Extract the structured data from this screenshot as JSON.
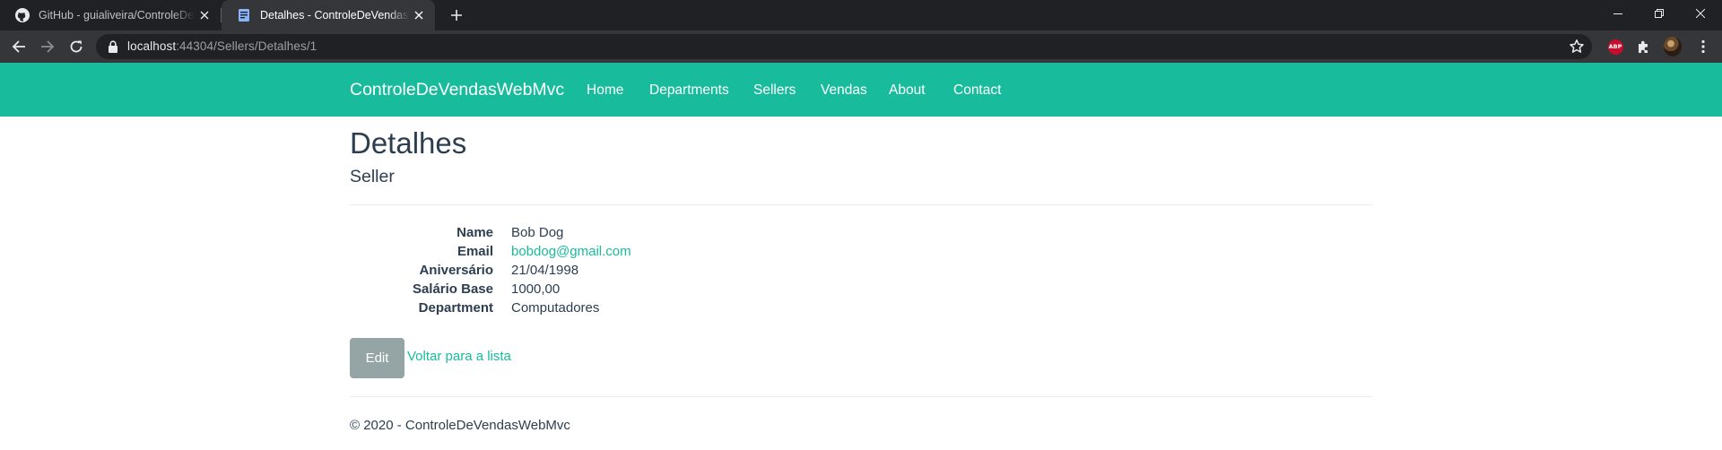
{
  "browser": {
    "tabs": [
      {
        "title": "GitHub - guialiveira/ControleDeVendasWebMvc",
        "favicon": "github-icon",
        "active": false
      },
      {
        "title": "Detalhes - ControleDeVendasWebMvc",
        "favicon": "document-icon",
        "active": true
      }
    ],
    "url": {
      "host": "localhost",
      "rest": ":44304/Sellers/Detalhes/1"
    },
    "extensions": {
      "abp_label": "ABP"
    }
  },
  "navbar": {
    "brand": "ControleDeVendasWebMvc",
    "links": [
      "Home",
      "Departments",
      "Sellers",
      "Vendas",
      "About",
      "Contact"
    ],
    "color": "#18bc9c"
  },
  "page": {
    "title": "Detalhes",
    "subtitle": "Seller",
    "fields": [
      {
        "label": "Name",
        "value": "Bob Dog"
      },
      {
        "label": "Email",
        "value": "bobdog@gmail.com"
      },
      {
        "label": "Aniversário",
        "value": "21/04/1998"
      },
      {
        "label": "Salário Base",
        "value": "1000,00"
      },
      {
        "label": "Department",
        "value": "Computadores"
      }
    ],
    "edit_label": "Edit",
    "back_label": "Voltar para a lista",
    "footer": "© 2020 - ControleDeVendasWebMvc"
  }
}
